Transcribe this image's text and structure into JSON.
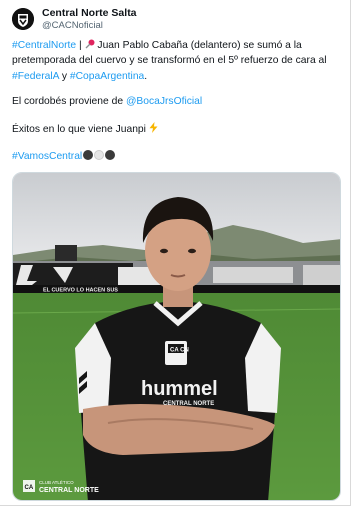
{
  "tweet": {
    "author_name": "Central Norte Salta",
    "author_handle": "@CACNoficial",
    "paragraph1": {
      "hashtag": "#CentralNorte",
      "separator": "|",
      "text_a": "Juan Pablo Cabaña (delantero) se sumó a la pretemporada del cuervo y se transformó en el 5º refuerzo de cara al",
      "hashtag_federal": "#FederalA",
      "text_y": "y",
      "hashtag_copa": "#CopaArgentina",
      "text_end": "."
    },
    "paragraph2": {
      "text": "El cordobés proviene de",
      "mention": "@BocaJrsOficial"
    },
    "paragraph3": {
      "text": "Éxitos en lo que viene Juanpi"
    },
    "paragraph4": {
      "hashtag": "#VamosCentral"
    },
    "icons": {
      "pin": "pushpin-icon",
      "lightning": "lightning-icon",
      "balls": [
        "black-circle-icon",
        "white-circle-icon",
        "black-circle-icon"
      ]
    },
    "media": {
      "billboard_text": "EL CUERVO LO HACEN SUS",
      "shirt_brand": "hummel",
      "shirt_text": "CENTRAL NORTE",
      "shirt_crest": "CA CN",
      "watermark_line1": "CLUB ATLÉTICO",
      "watermark_line2": "CENTRAL NORTE",
      "watermark_crest": "CA"
    }
  },
  "colors": {
    "link": "#1d9bf0",
    "text": "#0f1419",
    "secondary": "#536471",
    "lightning": "#f7b500"
  }
}
